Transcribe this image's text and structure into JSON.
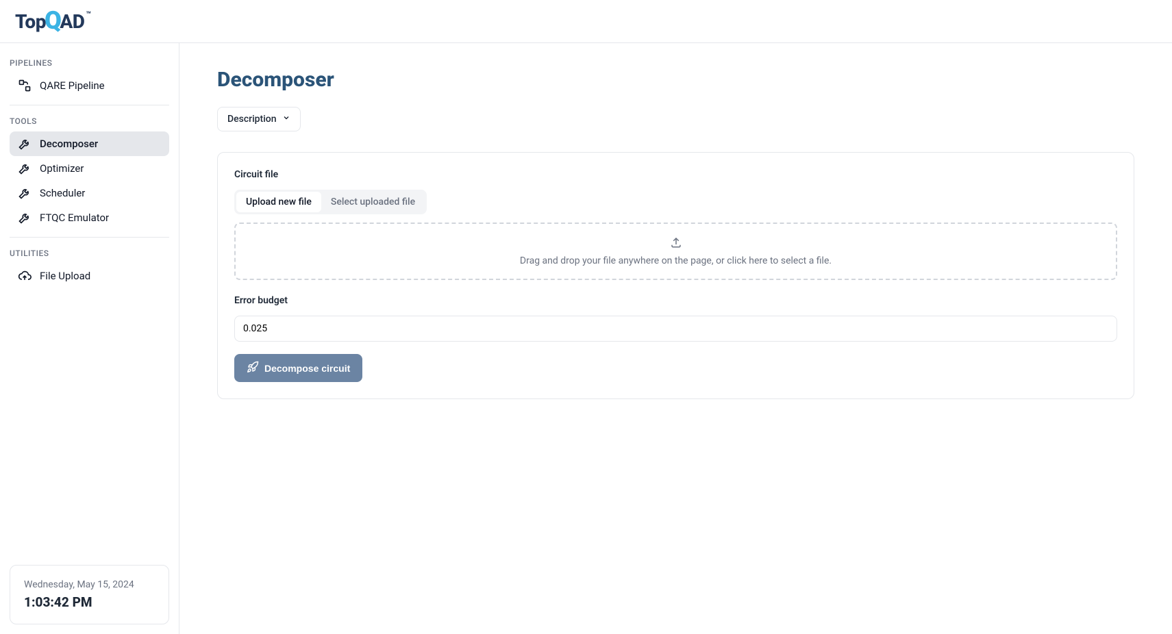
{
  "brand": {
    "top": "Top",
    "q": "Q",
    "ad": "AD",
    "tm": "™"
  },
  "sidebar": {
    "sections": {
      "pipelines": {
        "header": "PIPELINES",
        "items": [
          {
            "label": "QARE Pipeline"
          }
        ]
      },
      "tools": {
        "header": "TOOLS",
        "items": [
          {
            "label": "Decomposer"
          },
          {
            "label": "Optimizer"
          },
          {
            "label": "Scheduler"
          },
          {
            "label": "FTQC Emulator"
          }
        ]
      },
      "utilities": {
        "header": "UTILITIES",
        "items": [
          {
            "label": "File Upload"
          }
        ]
      }
    }
  },
  "datetime": {
    "date": "Wednesday, May 15, 2024",
    "time": "1:03:42 PM"
  },
  "page": {
    "title": "Decomposer",
    "descriptionDropdown": "Description",
    "circuitFile": {
      "label": "Circuit file",
      "tabs": {
        "upload": "Upload new file",
        "select": "Select uploaded file"
      },
      "dropzone": "Drag and drop your file anywhere on the page, or click here to select a file."
    },
    "errorBudget": {
      "label": "Error budget",
      "value": "0.025"
    },
    "submitLabel": "Decompose circuit"
  }
}
